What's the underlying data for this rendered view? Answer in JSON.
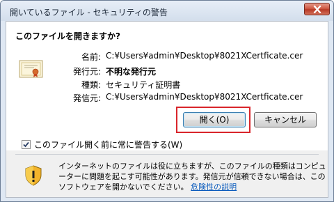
{
  "window": {
    "title": "開いているファイル - セキュリティの警告"
  },
  "dialog": {
    "question": "このファイルを開きますか?",
    "fields": [
      {
        "label": "名前:",
        "value": "C:¥Users¥admin¥Desktop¥8021XCertficate.cer",
        "bold": false
      },
      {
        "label": "発行元:",
        "value": "不明な発行元",
        "bold": true
      },
      {
        "label": "種類:",
        "value": "セキュリティ証明書",
        "bold": false
      },
      {
        "label": "発信元:",
        "value": "C:¥Users¥admin¥Desktop¥8021XCertficate.cer",
        "bold": false
      }
    ],
    "open_label": "開く(O)",
    "cancel_label": "キャンセル",
    "checkbox_label": "このファイル開く前に常に警告する(W)",
    "checkbox_checked": true,
    "warning_text": "インターネットのファイルは役に立ちますが、このファイルの種類はコンピューターに問題を起こす可能性があります。発信元が信頼できない場合は、このソフトウェアを開かないでください。",
    "warning_link": "危険性の説明"
  },
  "colors": {
    "highlight": "#d9252b",
    "link": "#0a5bbd",
    "close": "#c9432f"
  },
  "icons": [
    "close-icon",
    "certificate-icon",
    "check-icon",
    "shield-warning-icon"
  ]
}
